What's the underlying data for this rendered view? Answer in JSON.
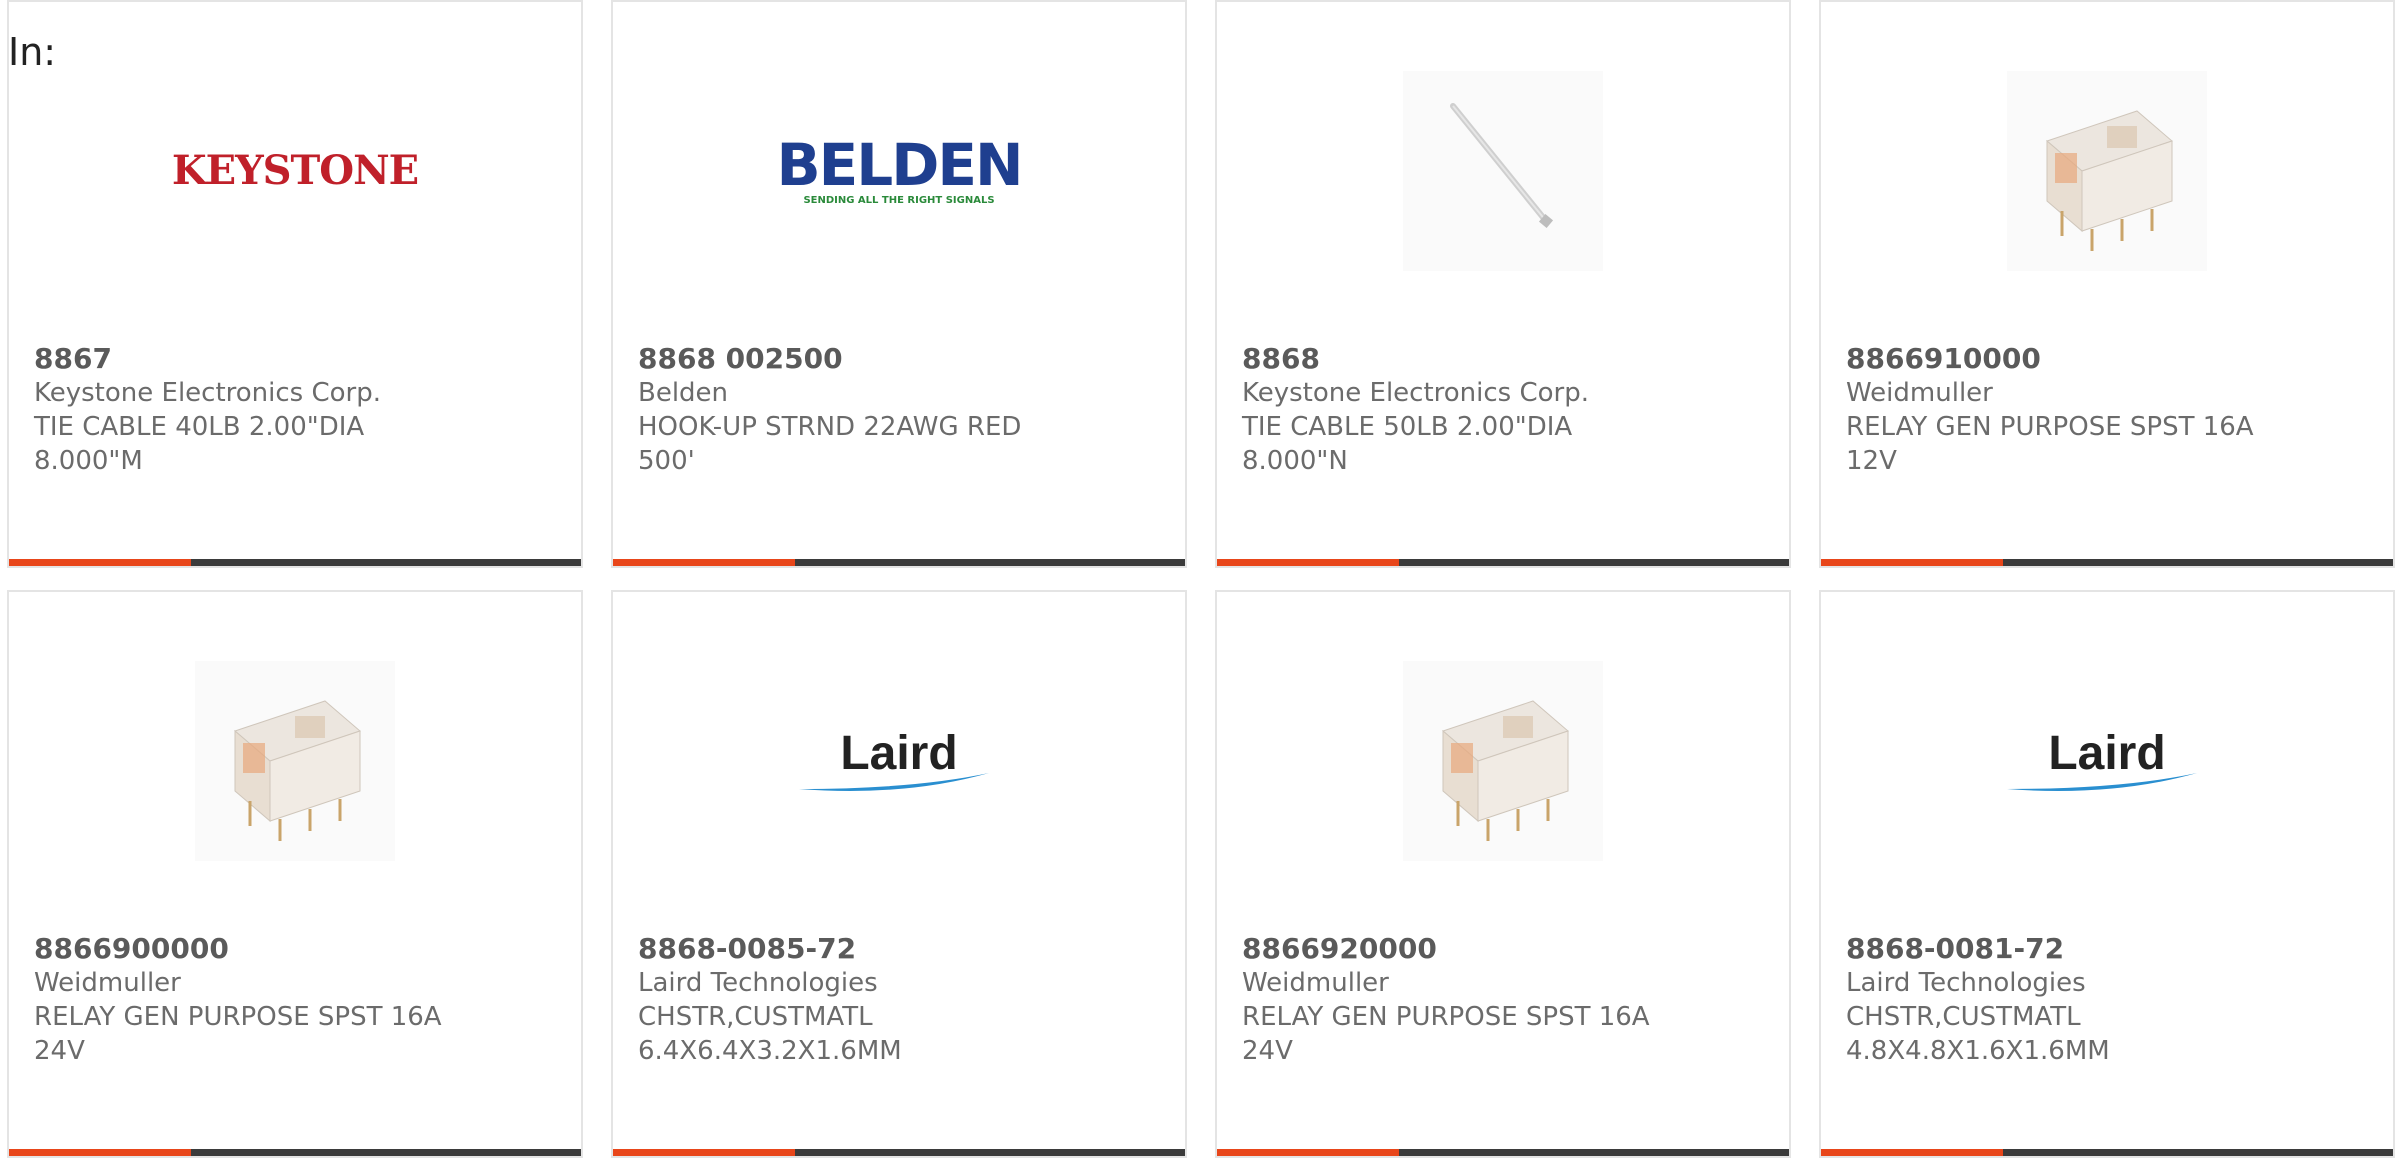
{
  "header": {
    "label": "In:"
  },
  "colors": {
    "accent": "#e8461a",
    "bar": "#3b3b3b",
    "border": "#e4e4e4",
    "text": "#6b6b6b"
  },
  "products": [
    {
      "part_number": "8867",
      "manufacturer": "Keystone Electronics Corp.",
      "description": "TIE CABLE 40LB 2.00\"DIA 8.000\"M",
      "image": "keystone-logo"
    },
    {
      "part_number": "8868 002500",
      "manufacturer": "Belden",
      "description": "HOOK-UP STRND 22AWG RED 500'",
      "image": "belden-logo"
    },
    {
      "part_number": "8868",
      "manufacturer": "Keystone Electronics Corp.",
      "description": "TIE CABLE 50LB 2.00\"DIA 8.000\"N",
      "image": "cable-tie-photo"
    },
    {
      "part_number": "8866910000",
      "manufacturer": "Weidmuller",
      "description": "RELAY GEN PURPOSE SPST 16A 12V",
      "image": "relay-photo"
    },
    {
      "part_number": "8866900000",
      "manufacturer": "Weidmuller",
      "description": "RELAY GEN PURPOSE SPST 16A 24V",
      "image": "relay-photo"
    },
    {
      "part_number": "8868-0085-72",
      "manufacturer": "Laird Technologies",
      "description": "CHSTR,CUSTMATL 6.4X6.4X3.2X1.6MM",
      "image": "laird-logo"
    },
    {
      "part_number": "8866920000",
      "manufacturer": "Weidmuller",
      "description": "RELAY GEN PURPOSE SPST 16A 24V",
      "image": "relay-photo"
    },
    {
      "part_number": "8868-0081-72",
      "manufacturer": "Laird Technologies",
      "description": "CHSTR,CUSTMATL 4.8X4.8X1.6X1.6MM",
      "image": "laird-logo"
    }
  ],
  "logos": {
    "keystone": {
      "text": "KEYSTONE"
    },
    "belden": {
      "text": "BELDEN",
      "tagline": "SENDING ALL THE RIGHT SIGNALS"
    },
    "laird": {
      "text": "Laird"
    }
  }
}
